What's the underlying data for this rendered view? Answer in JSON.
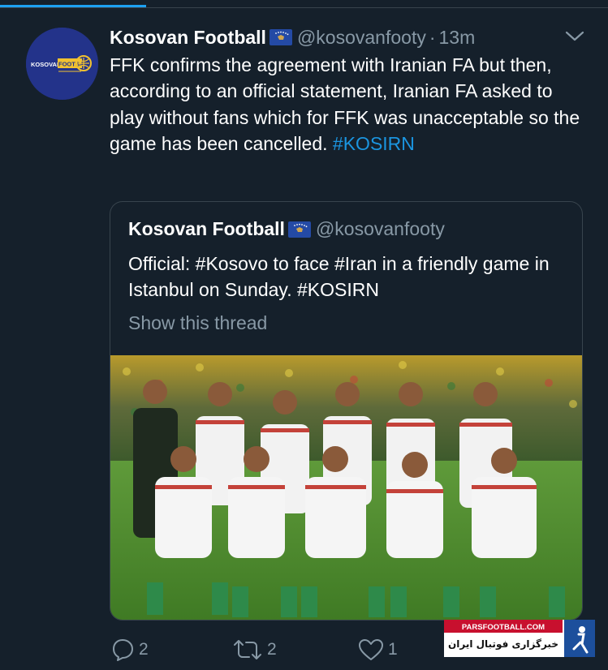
{
  "tweet": {
    "author_name": "Kosovan Football",
    "author_handle": "@kosovanfooty",
    "separator": "·",
    "time": "13m",
    "avatar_text_left": "KOSOVAN",
    "avatar_text_right": "FOOTBALL",
    "text_before_hashtag": "FFK confirms the agreement with Iranian FA but then, according to an official statement, Iranian FA asked to play without fans which for FFK was unacceptable so the game has been cancelled. ",
    "hashtag": "#KOSIRN"
  },
  "quoted_tweet": {
    "author_name": "Kosovan Football",
    "author_handle": "@kosovanfooty",
    "text": "Official: #Kosovo to face #Iran in a friendly game in Istanbul on Sunday. #KOSIRN",
    "show_thread": "Show this thread",
    "photo_description_icon": "team-photo"
  },
  "actions": {
    "reply_count": "2",
    "retweet_count": "2",
    "like_count": "1"
  },
  "watermark": {
    "site": "PARSFOOTBALL.COM",
    "persian_text": "خبرگزاری فوتبال ایران"
  },
  "colors": {
    "background": "#15202b",
    "border": "#38444d",
    "secondary_text": "#8899a6",
    "accent": "#1da1f2",
    "hashtag": "#1b95e0"
  }
}
